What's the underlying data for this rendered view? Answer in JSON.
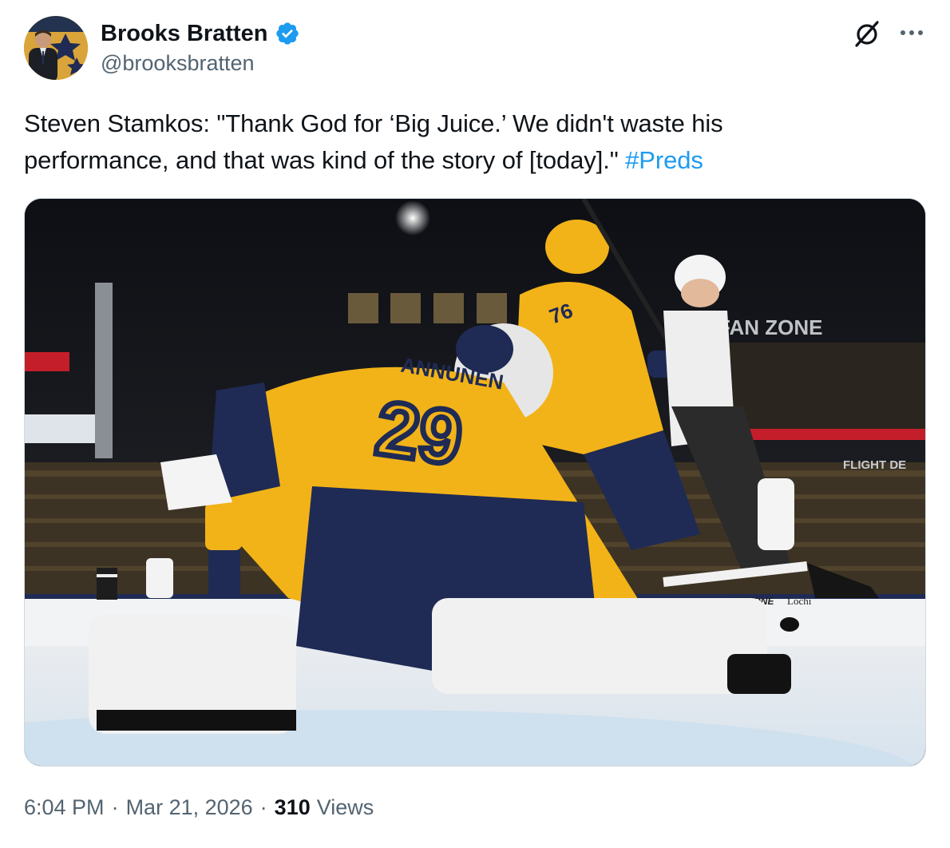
{
  "author": {
    "display_name": "Brooks Bratten",
    "handle": "@brooksbratten",
    "verified": true,
    "avatar_icon": "avatar-photo"
  },
  "tweet": {
    "text_line1": "Steven Stamkos: \"Thank God for ‘Big Juice.’ We didn't waste his",
    "text_line2": "performance, and that was kind of the story of [today].\" ",
    "hashtag": "#Preds"
  },
  "media": {
    "icon": "hockey-photo",
    "jersey_name": "ANNUNEN",
    "jersey_number": "29",
    "teammate_number": "76",
    "background_signs": {
      "fan_zone": "FAN ZONE",
      "flight": "FLIGHT DE",
      "board_left": "GESTONE",
      "board_right": "Lochi"
    }
  },
  "footer": {
    "time": "6:04 PM",
    "date": "Mar 21, 2026",
    "views_count": "310",
    "views_label": "Views",
    "separator": "·"
  },
  "icons": {
    "verified": "verified-badge-icon",
    "grok": "grok-icon",
    "more": "more-options-icon"
  },
  "colors": {
    "link": "#1d9bf0",
    "secondary_text": "#536471",
    "verified": "#1d9bf0",
    "preds_gold": "#F2B318",
    "preds_navy": "#1f2b55"
  }
}
